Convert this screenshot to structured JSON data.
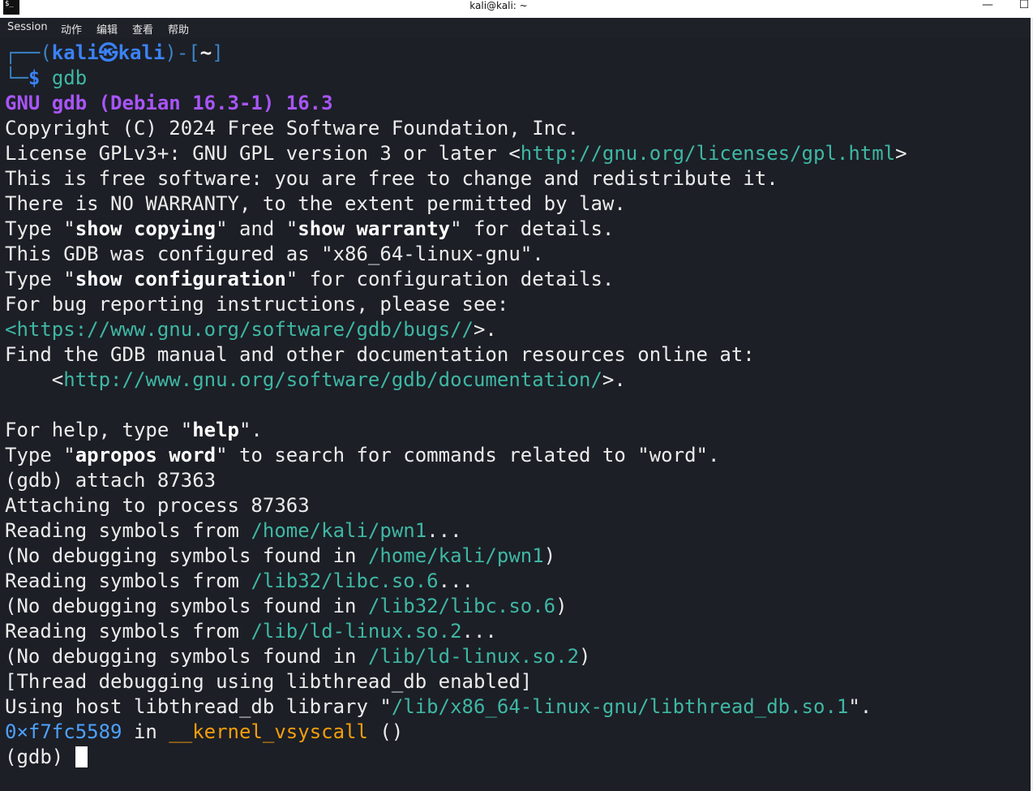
{
  "window": {
    "title": "kali@kali: ~",
    "icon": "terminal-icon",
    "minimize": "—",
    "maximize": "☐"
  },
  "menu": [
    "Session",
    "动作",
    "编辑",
    "查看",
    "帮助"
  ],
  "prompt": {
    "line1_pre": "┌──(",
    "user": "kali",
    "skull": "㉿",
    "host": "kali",
    "line1_mid": ")-[",
    "dir": "~",
    "line1_end": "]",
    "line2_pre": "└─",
    "symbol": "$",
    "command": "gdb"
  },
  "out": {
    "banner": "GNU gdb (Debian 16.3-1) 16.3",
    "copyright": "Copyright (C) 2024 Free Software Foundation, Inc.",
    "license_pre": "License GPLv3+: GNU GPL version 3 or later <",
    "license_url": "http://gnu.org/licenses/gpl.html",
    "license_post": ">",
    "free": "This is free software: you are free to change and redistribute it.",
    "warranty": "There is NO WARRANTY, to the extent permitted by law.",
    "type1_a": "Type \"",
    "type1_b": "show copying",
    "type1_c": "\" and \"",
    "type1_d": "show warranty",
    "type1_e": "\" for details.",
    "configured": "This GDB was configured as \"x86_64-linux-gnu\".",
    "type2_a": "Type \"",
    "type2_b": "show configuration",
    "type2_c": "\" for configuration details.",
    "bug": "For bug reporting instructions, please see:",
    "bugs_pre": "<",
    "bugs_url": "https://www.gnu.org/software/gdb/bugs/",
    "bugs_post": ">.",
    "manual": "Find the GDB manual and other documentation resources online at:",
    "doc_pre": "    <",
    "doc_url": "http://www.gnu.org/software/gdb/documentation/",
    "doc_post": ">.",
    "help_a": "For help, type \"",
    "help_b": "help",
    "help_c": "\".",
    "apropos_a": "Type \"",
    "apropos_b": "apropos word",
    "apropos_c": "\" to search for commands related to \"word\".",
    "attach_cmd": "(gdb) attach 87363",
    "attaching": "Attaching to process 87363",
    "read1_a": "Reading symbols from ",
    "read1_path": "/home/kali/pwn1",
    "read1_c": "...",
    "nodbg1_a": "(No debugging symbols found in ",
    "nodbg1_path": "/home/kali/pwn1",
    "nodbg1_c": ")",
    "read2_a": "Reading symbols from ",
    "read2_path": "/lib32/libc.so.6",
    "read2_c": "...",
    "nodbg2_a": "(No debugging symbols found in ",
    "nodbg2_path": "/lib32/libc.so.6",
    "nodbg2_c": ")",
    "read3_a": "Reading symbols from ",
    "read3_path": "/lib/ld-linux.so.2",
    "read3_c": "...",
    "nodbg3_a": "(No debugging symbols found in ",
    "nodbg3_path": "/lib/ld-linux.so.2",
    "nodbg3_c": ")",
    "thread": "[Thread debugging using libthread_db enabled]",
    "host_a": "Using host libthread_db library \"",
    "host_path": "/lib/x86_64-linux-gnu/libthread_db.so.1",
    "host_c": "\".",
    "addr": "0×f7fc5589",
    "in": " in ",
    "func": "__kernel_vsyscall",
    "func_args": " ()",
    "final_prompt": "(gdb) "
  },
  "colors": {
    "terminal_bg": "#1c1f26",
    "text": "#ececec",
    "url": "#3fb7a4",
    "banner": "#a855f7",
    "prompt_blue": "#3b82f6",
    "function": "#f59e0b"
  }
}
